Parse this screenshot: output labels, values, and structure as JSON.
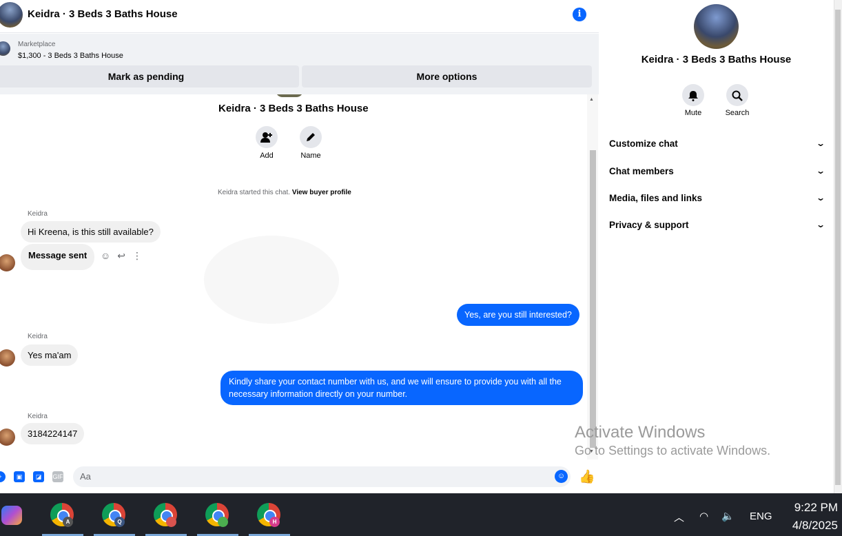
{
  "header": {
    "title": "Keidra · 3 Beds 3 Baths House",
    "info_icon": "info-icon"
  },
  "marketplace": {
    "label": "Marketplace",
    "listing": "$1,300 - 3 Beds 3 Baths House",
    "pending_button": "Mark as pending",
    "options_button": "More options"
  },
  "intro": {
    "title": "Keidra · 3 Beds 3 Baths House",
    "add_label": "Add",
    "name_label": "Name",
    "started_text": "Keidra started this chat.",
    "buyer_profile_link": "View buyer profile"
  },
  "messages": [
    {
      "sender": "Keidra",
      "text": "Hi Kreena, is this still available?"
    },
    {
      "text": "Message sent"
    },
    {
      "text": "Yes, are you still interested?"
    },
    {
      "sender": "Keidra",
      "text": "Yes ma'am"
    },
    {
      "text": "Kindly share your contact number with us, and we will ensure to provide you with all the necessary information directly on your number."
    },
    {
      "sender": "Keidra",
      "text": "3184224147"
    }
  ],
  "composer": {
    "placeholder": "Aa"
  },
  "sidebar": {
    "title": "Keidra · 3 Beds 3 Baths House",
    "mute_label": "Mute",
    "search_label": "Search",
    "menu": [
      "Customize chat",
      "Chat members",
      "Media, files and links",
      "Privacy & support"
    ]
  },
  "watermark": {
    "line1": "Activate Windows",
    "line2": "Go to Settings to activate Windows."
  },
  "taskbar": {
    "apps": [
      "A",
      "Q",
      "",
      "",
      "H"
    ],
    "lang": "ENG",
    "time": "9:22 PM",
    "date": "4/8/2025"
  },
  "colors": {
    "messenger_blue": "#0866ff",
    "taskbar": "#20232a"
  }
}
